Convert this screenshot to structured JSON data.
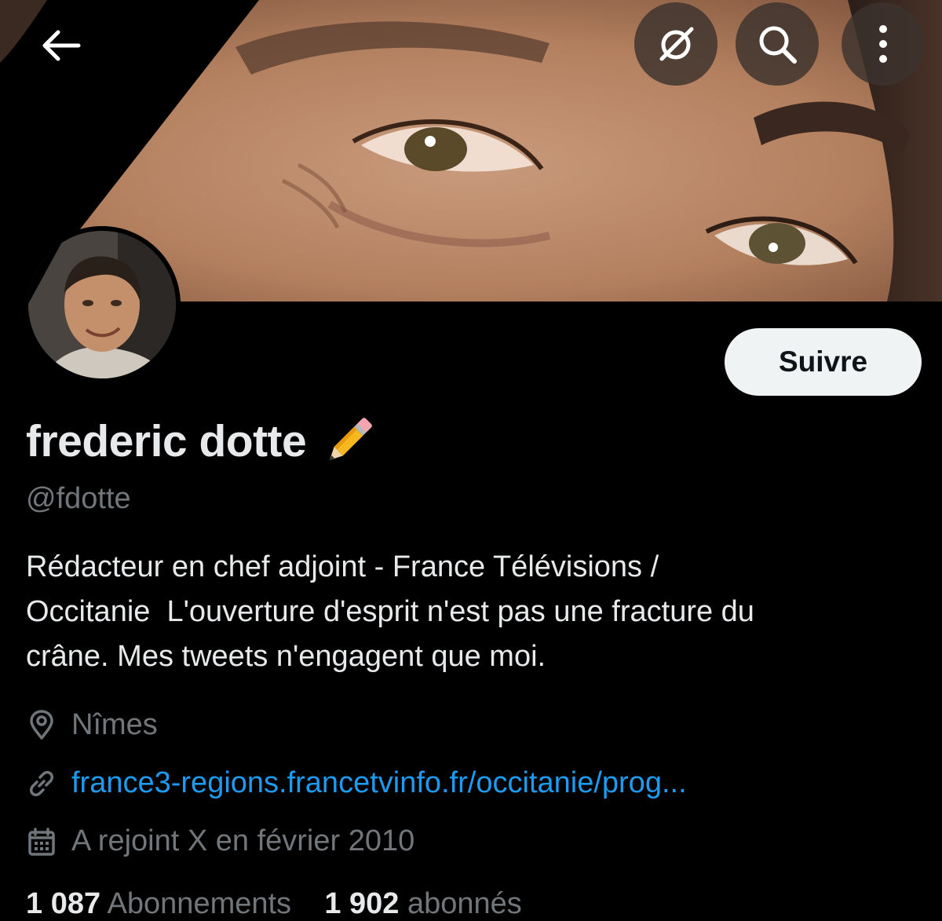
{
  "header": {
    "back_icon": "arrow-left-icon",
    "actions": [
      {
        "name": "grok-icon"
      },
      {
        "name": "search-icon"
      },
      {
        "name": "more-vertical-icon"
      }
    ]
  },
  "profile": {
    "name": "frederic dotte",
    "name_emoji": "pencil-icon",
    "handle": "@fdotte",
    "follow_label": "Suivre",
    "bio_lines": [
      "Rédacteur en chef adjoint - France Télévisions /",
      "Occitanie  L'ouverture d'esprit n'est pas une fracture du",
      "crâne. Mes tweets n'engagent que moi."
    ],
    "location": "Nîmes",
    "website": "france3-regions.francetvinfo.fr/occitanie/prog...",
    "joined": "A rejoint X en février 2010",
    "following_count": "1 087",
    "following_label": "Abonnements",
    "followers_count": "1 902",
    "followers_label": "abonnés"
  },
  "colors": {
    "background": "#000000",
    "text_primary": "#e7e9ea",
    "text_secondary": "#71767b",
    "link": "#1d9bf0",
    "follow_button": "#eff3f4"
  }
}
